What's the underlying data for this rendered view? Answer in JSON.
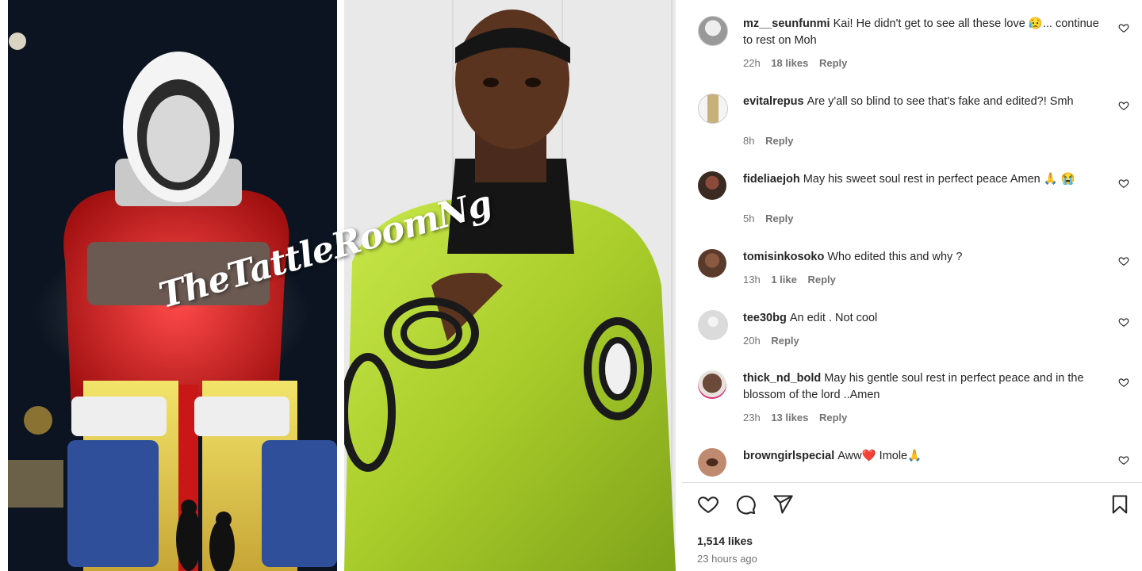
{
  "post": {
    "watermark": "TheTattleRoomNg",
    "likes": "1,514 likes",
    "time_ago": "23 hours ago"
  },
  "comments": [
    {
      "username": "mz__seunfunmi",
      "text": "Kai! He didn't get to see all these love 😥... continue to rest on Moh",
      "time": "22h",
      "likes": "18 likes",
      "reply": "Reply"
    },
    {
      "username": "evitalrepus",
      "text": "Are y'all so blind to see that's fake and edited?! Smh",
      "time": "8h",
      "likes": "",
      "reply": "Reply"
    },
    {
      "username": "fideliaejoh",
      "text": "May his sweet soul rest in perfect peace Amen 🙏 😭",
      "time": "5h",
      "likes": "",
      "reply": "Reply"
    },
    {
      "username": "tomisinkosoko",
      "text": "Who edited this and why ?",
      "time": "13h",
      "likes": "1 like",
      "reply": "Reply"
    },
    {
      "username": "tee30bg",
      "text": "An edit . Not cool",
      "time": "20h",
      "likes": "",
      "reply": "Reply"
    },
    {
      "username": "thick_nd_bold",
      "text": "May his gentle soul rest in perfect peace and in the blossom of the lord ..Amen",
      "time": "23h",
      "likes": "13 likes",
      "reply": "Reply"
    },
    {
      "username": "browngirlspecial",
      "text": "Aww❤️ Imole🙏",
      "time": "",
      "likes": "",
      "reply": ""
    }
  ],
  "icons": {
    "comment_like": "heart-outline-icon",
    "like": "heart-icon",
    "comment": "comment-bubble-icon",
    "share": "paper-plane-icon",
    "save": "bookmark-icon"
  },
  "colors": {
    "text": "#262626",
    "muted": "#737373",
    "divider": "#dbdbdb"
  }
}
